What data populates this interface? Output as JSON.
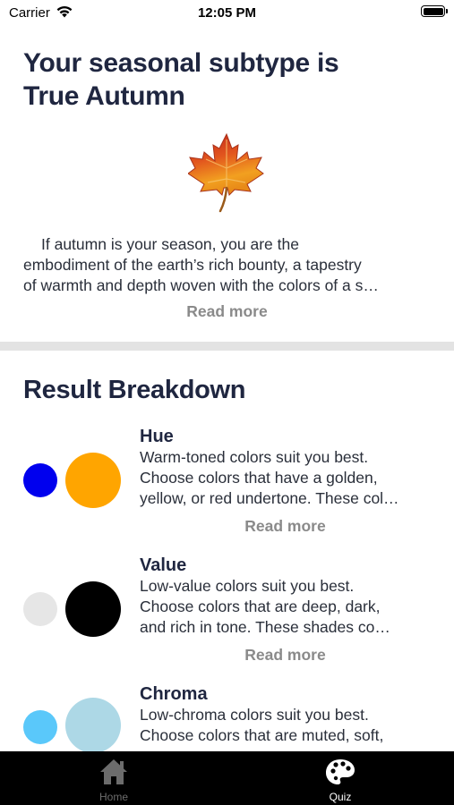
{
  "status_bar": {
    "carrier": "Carrier",
    "time": "12:05 PM"
  },
  "result": {
    "title_line1": "Your seasonal subtype is",
    "title_line2": "True Autumn",
    "icon": "maple-leaf-icon",
    "intro_lines": [
      "If autumn is your season, you are the",
      "embodiment of the earth’s rich bounty, a tapestry",
      "of warmth and depth woven with the colors of a s…"
    ],
    "read_more": "Read more"
  },
  "breakdown": {
    "title": "Result Breakdown",
    "items": [
      {
        "heading": "Hue",
        "lines": [
          "Warm-toned colors suit you best.",
          "Choose colors that have a golden,",
          "yellow, or red undertone. These col…"
        ],
        "read_more": "Read more",
        "swatch_small_color": "#0000ee",
        "swatch_large_color": "#ffa500"
      },
      {
        "heading": "Value",
        "lines": [
          "Low-value colors suit you best.",
          "Choose colors that are deep, dark,",
          "and rich in tone. These shades co…"
        ],
        "read_more": "Read more",
        "swatch_small_color": "#e6e6e6",
        "swatch_large_color": "#000000"
      },
      {
        "heading": "Chroma",
        "lines": [
          "Low-chroma colors suit you best.",
          "Choose colors that are muted, soft,"
        ],
        "swatch_small_color": "#5ac8fa",
        "swatch_large_color": "#add8e6"
      }
    ]
  },
  "tab_bar": {
    "tabs": [
      {
        "label": "Home",
        "icon": "home-icon",
        "selected": false
      },
      {
        "label": "Quiz",
        "icon": "palette-icon",
        "selected": true
      }
    ]
  }
}
